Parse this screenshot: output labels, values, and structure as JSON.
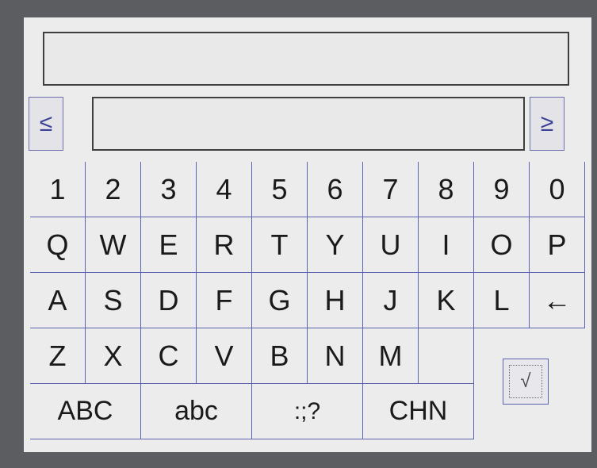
{
  "nav": {
    "left_symbol": "≤",
    "right_symbol": "≥"
  },
  "rows": [
    [
      "1",
      "2",
      "3",
      "4",
      "5",
      "6",
      "7",
      "8",
      "9",
      "0"
    ],
    [
      "Q",
      "W",
      "E",
      "R",
      "T",
      "Y",
      "U",
      "I",
      "O",
      "P"
    ],
    [
      "A",
      "S",
      "D",
      "F",
      "G",
      "H",
      "J",
      "K",
      "L",
      "←"
    ],
    [
      "Z",
      "X",
      "C",
      "V",
      "B",
      "N",
      "M",
      ""
    ]
  ],
  "mode_keys": [
    "ABC",
    "abc",
    ":;?",
    "CHN"
  ],
  "confirm_symbol": "√"
}
